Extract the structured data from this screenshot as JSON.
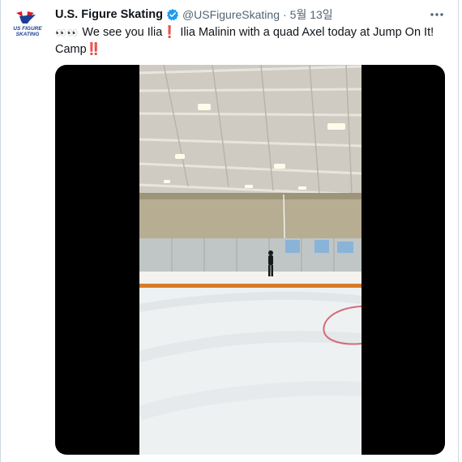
{
  "account": {
    "name": "U.S. Figure Skating",
    "handle": "@USFigureSkating",
    "separator": "·",
    "date": "5월 13일",
    "logo_text_top": "US FIGURE",
    "logo_text_bottom": "SKATING"
  },
  "tweet": {
    "eyes_emoji": "👀👀",
    "text_part1": " We see you Ilia",
    "exclaim1": "❗",
    "text_part2": " Ilia Malinin with a quad Axel today at Jump On It!",
    "text_part3": "Camp",
    "exclaim2": "‼️"
  },
  "icons": {
    "verified": "verified-badge-icon",
    "more": "more-options-icon",
    "logo": "us-figure-skating-logo"
  },
  "colors": {
    "verified_blue": "#1d9bf0",
    "text_primary": "#0f1419",
    "text_secondary": "#536471",
    "exclaim_red": "#e0162b",
    "media_bg": "#000000"
  }
}
